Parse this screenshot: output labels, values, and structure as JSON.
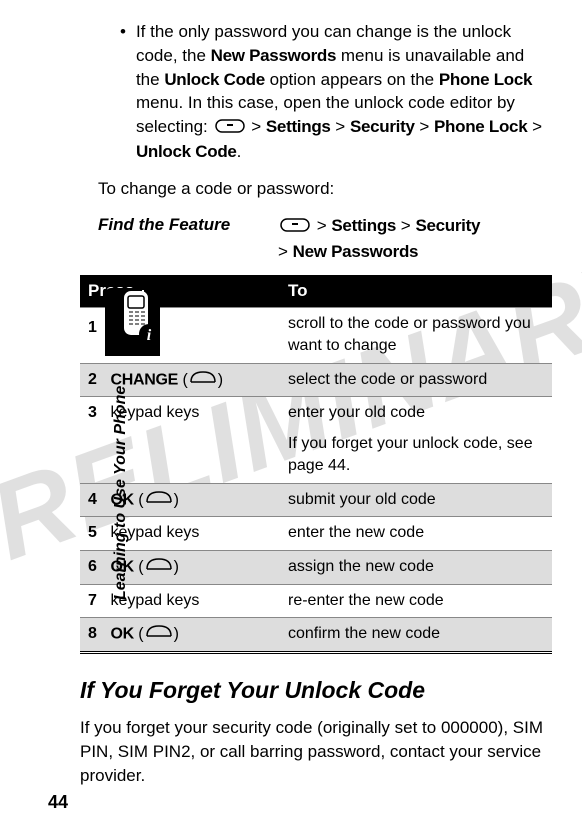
{
  "watermark": "PRELIMINARY",
  "bullet": {
    "text_parts": {
      "p1": "If the only password you can change is the unlock code, the ",
      "p2": " menu is unavailable and the ",
      "p3": " option appears on the ",
      "p4": " menu. In this case, open the unlock code editor by selecting: ",
      "path1": "Settings",
      "path2": "Security",
      "path3": "Phone Lock",
      "path4": "Unlock Code",
      "new_passwords": "New Passwords",
      "unlock_code": "Unlock Code",
      "phone_lock": "Phone Lock",
      "period": "."
    }
  },
  "intro": "To change a code or password:",
  "find_feature": {
    "label": "Find the Feature",
    "gt": ">",
    "p1": "Settings",
    "p2": "Security",
    "p3": "New Passwords"
  },
  "sidebar": "Learning to Use Your Phone",
  "table": {
    "head_press": "Press",
    "head_to": "To",
    "rows": [
      {
        "num": "1",
        "press_special": "nav",
        "press": "",
        "to": "scroll to the code or password you want to change"
      },
      {
        "num": "2",
        "press_special": "softkey",
        "press": "CHANGE",
        "to": "select the code or password"
      },
      {
        "num": "3",
        "press_special": "",
        "press": "keypad keys",
        "to": "enter your old code",
        "to2": "If you forget your unlock code, see page 44."
      },
      {
        "num": "4",
        "press_special": "softkey",
        "press": "OK",
        "to": "submit your old code"
      },
      {
        "num": "5",
        "press_special": "",
        "press": "keypad keys",
        "to": "enter the new code"
      },
      {
        "num": "6",
        "press_special": "softkey",
        "press": "OK",
        "to": "assign the new code"
      },
      {
        "num": "7",
        "press_special": "",
        "press": "keypad keys",
        "to": "re-enter the new code"
      },
      {
        "num": "8",
        "press_special": "softkey",
        "press": "OK",
        "to": "confirm the new code"
      }
    ]
  },
  "section_heading": "If You Forget Your Unlock Code",
  "forget_para": "If you forget your security code (originally set to 000000), SIM PIN, SIM PIN2, or call barring password, contact your service provider.",
  "page_number": "44",
  "gt": " > "
}
